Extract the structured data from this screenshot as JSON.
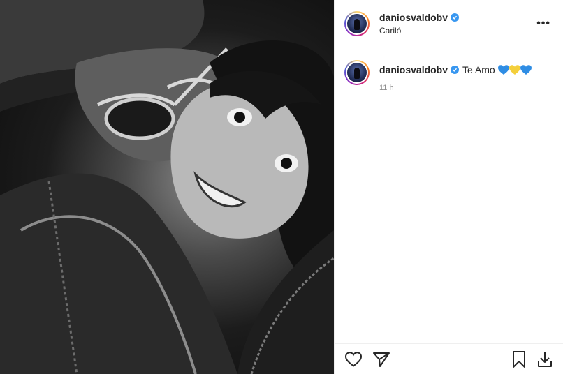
{
  "post": {
    "username": "daniosvaldobv",
    "verified": true,
    "location": "Cariló",
    "more_label": "•••",
    "caption": "Te Amo",
    "caption_emojis": [
      "blue-heart",
      "yellow-heart",
      "blue-heart"
    ],
    "time_ago": "11 h"
  },
  "colors": {
    "verified_badge": "#3897f0",
    "heart_blue": "#2f8de4",
    "heart_yellow": "#f4cf3b",
    "muted_text": "#8e8e8e",
    "divider": "#efefef"
  },
  "icons": {
    "header": [
      "more-options-icon",
      "verified-badge-icon"
    ],
    "actions": [
      "heart-icon",
      "share-icon",
      "bookmark-icon",
      "download-icon"
    ]
  }
}
